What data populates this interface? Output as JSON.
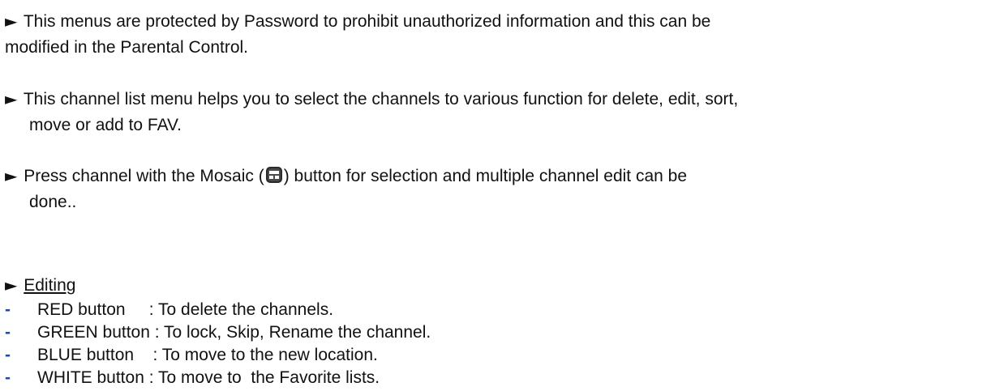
{
  "bullets": [
    {
      "line1": "This menus are protected by Password to prohibit unauthorized information and this can be",
      "line2": "modified in the Parental Control."
    },
    {
      "line1": "This channel list menu helps you to select the channels to various function for delete, edit, sort,",
      "line2": "move or add to FAV."
    },
    {
      "part1": "Press channel with the Mosaic (",
      "part2": ") button for selection and multiple channel edit can be",
      "line2": "done..",
      "icon": "mosaic-icon"
    }
  ],
  "editing": {
    "heading": "Editing",
    "items": [
      {
        "button": "RED button",
        "spacer": "     ",
        "desc": ": To delete the channels."
      },
      {
        "button": "GREEN button",
        "spacer": " ",
        "desc": ": To lock, Skip, Rename the channel."
      },
      {
        "button": "BLUE button",
        "spacer": "    ",
        "desc": ": To move to the new location."
      },
      {
        "button": "WHITE button",
        "spacer": " ",
        "desc": ": To move to  the Favorite lists."
      }
    ]
  },
  "colors": {
    "text": "#111111",
    "dash": "#1f4aa8"
  }
}
